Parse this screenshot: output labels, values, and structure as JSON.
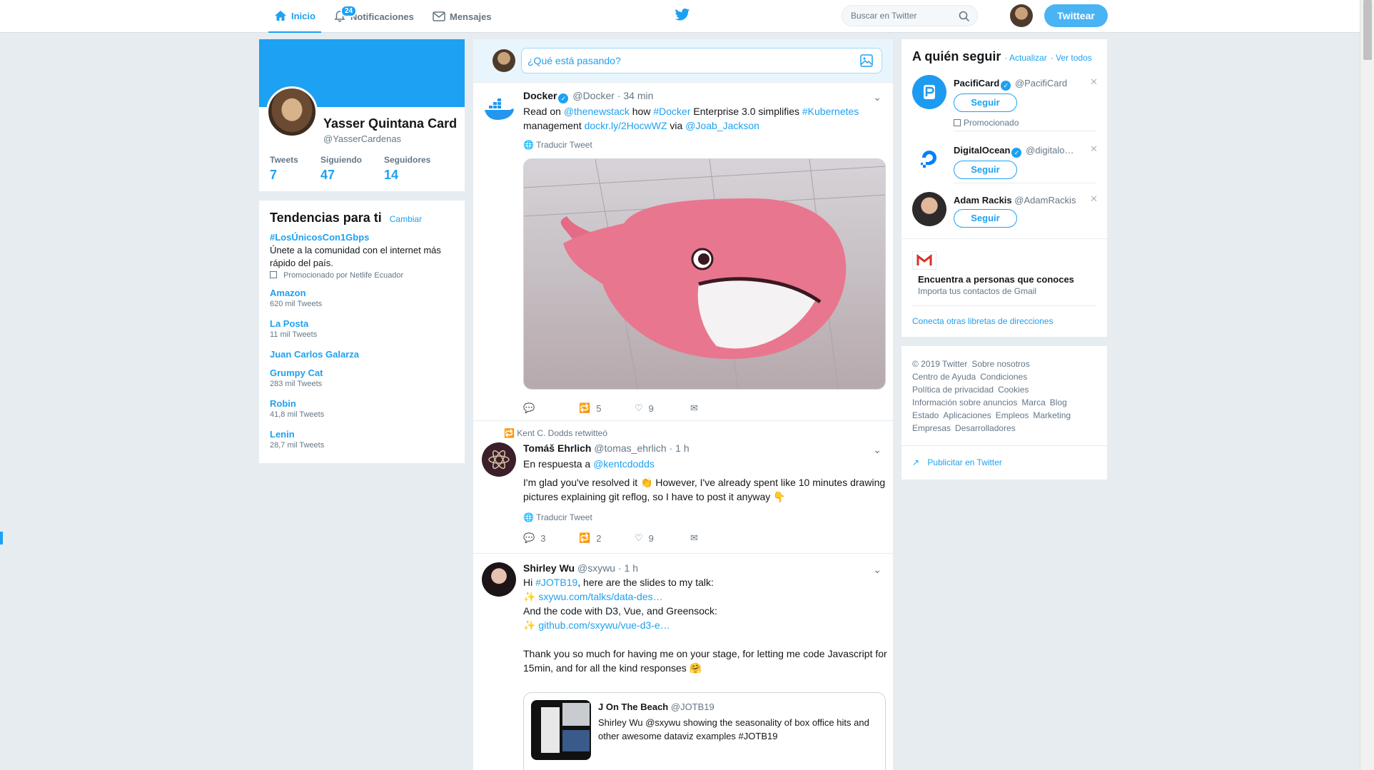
{
  "nav": {
    "home": "Inicio",
    "notifications": "Notificaciones",
    "notifications_count": "24",
    "messages": "Mensajes",
    "search_placeholder": "Buscar en Twitter",
    "tweet_button": "Twittear"
  },
  "profile": {
    "name": "Yasser Quintana Card",
    "handle": "@YasserCardenas",
    "stats": [
      {
        "label": "Tweets",
        "value": "7"
      },
      {
        "label": "Siguiendo",
        "value": "47"
      },
      {
        "label": "Seguidores",
        "value": "14"
      }
    ]
  },
  "trends": {
    "title": "Tendencias para ti",
    "change": "Cambiar",
    "promoted": {
      "name": "#LosÚnicosCon1Gbps",
      "desc": "Únete a la comunidad con el internet más rápido del país.",
      "sub": "Promocionado por Netlife Ecuador"
    },
    "items": [
      {
        "name": "Amazon",
        "count": "620 mil Tweets"
      },
      {
        "name": "La Posta",
        "count": "11 mil Tweets"
      },
      {
        "name": "Juan Carlos Galarza",
        "count": ""
      },
      {
        "name": "Grumpy Cat",
        "count": "283 mil Tweets"
      },
      {
        "name": "Robin",
        "count": "41,8 mil Tweets"
      },
      {
        "name": "Lenin",
        "count": "28,7 mil Tweets"
      }
    ]
  },
  "compose": {
    "placeholder": "¿Qué está pasando?"
  },
  "tweets": [
    {
      "name": "Docker",
      "handle": "@Docker",
      "time": "· 34 min",
      "text_1": "Read on ",
      "link_1": "@thenewstack",
      "text_2": " how ",
      "link_2": "#Docker",
      "text_3": " Enterprise 3.0 simplifies ",
      "link_3": "#Kubernetes",
      "text_4": " management ",
      "link_4": "dockr.ly/2HocwWZ",
      "text_5": " via ",
      "link_5": "@Joab_Jackson",
      "translate": "Traducir Tweet",
      "replies": "",
      "retweets": "5",
      "likes": "9"
    },
    {
      "retweeted_by": "Kent C. Dodds retwitteó",
      "name": "Tomáš Ehrlich",
      "handle": "@tomas_ehrlich",
      "time": "· 1 h",
      "reply_to_label": "En respuesta a ",
      "reply_to": "@kentcdodds",
      "text": "I'm glad you've resolved it 👏 However, I've already spent like 10 minutes drawing pictures explaining git reflog, so I have to post it anyway 👇",
      "translate": "Traducir Tweet",
      "replies": "3",
      "retweets": "2",
      "likes": "9"
    },
    {
      "name": "Shirley Wu",
      "handle": "@sxywu",
      "time": "· 1 h",
      "line_1a": "Hi ",
      "line_1b": "#JOTB19",
      "line_1c": ", here are the slides to my talk:",
      "link_slides": "sxywu.com/talks/data-des…",
      "line_code": "And the code with D3, Vue, and Greensock:",
      "link_code": "github.com/sxywu/vue-d3-e…",
      "thanks": "Thank you so much for having me on your stage, for letting me code Javascript for 15min, and for all the kind responses 🤗",
      "quote": {
        "name": "J On The Beach",
        "handle": "@JOTB19",
        "text": "Shirley Wu @sxywu  showing the seasonality of box office hits and other awesome dataviz examples #JOTB19"
      }
    }
  ],
  "who_to_follow": {
    "title": "A quién seguir",
    "refresh": "· Actualizar",
    "view_all": "· Ver todos",
    "follow_label": "Seguir",
    "accounts": [
      {
        "name": "PacifiCard",
        "handle": "@PacifiCard",
        "promoted": "Promocionado"
      },
      {
        "name": "DigitalOcean",
        "handle": "@digitalo…",
        "promoted": ""
      },
      {
        "name": "Adam Rackis",
        "handle": "@AdamRackis",
        "promoted": ""
      }
    ],
    "find_title": "Encuentra a personas que conoces",
    "find_sub": "Importa tus contactos de Gmail",
    "connect": "Conecta otras libretas de direcciones"
  },
  "footer": {
    "links": [
      "© 2019 Twitter",
      "Sobre nosotros",
      "Centro de Ayuda",
      "Condiciones",
      "Política de privacidad",
      "Cookies",
      "Información sobre anuncios",
      "Marca",
      "Blog",
      "Estado",
      "Aplicaciones",
      "Empleos",
      "Marketing",
      "Empresas",
      "Desarrolladores"
    ],
    "advertise": "Publicitar en Twitter"
  },
  "colors": {
    "accent": "#1da1f2",
    "background": "#e6ecf0"
  }
}
